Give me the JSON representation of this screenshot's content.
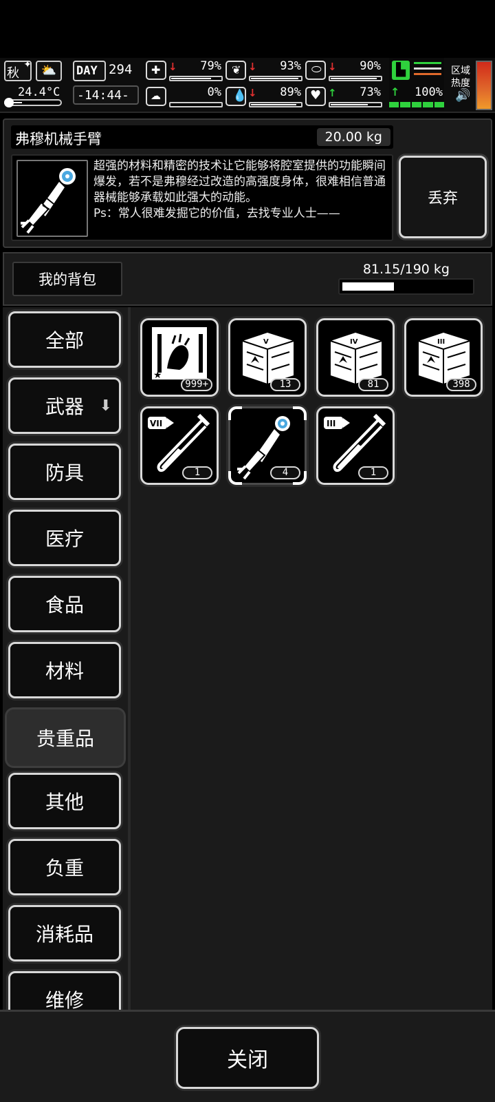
{
  "hud": {
    "season": "秋",
    "temperature": "24.4°C",
    "day_label": "DAY",
    "day": "294",
    "time": "-14:44-",
    "region_heat_label_1": "区域",
    "region_heat_label_2": "热度",
    "stats": [
      {
        "name": "health",
        "arrow": "↓",
        "dir": "down",
        "value": "79%",
        "level": 0.79
      },
      {
        "name": "hunger",
        "arrow": "↓",
        "dir": "down",
        "value": "93%",
        "level": 0.93
      },
      {
        "name": "pill",
        "arrow": "↓",
        "dir": "down",
        "value": "90%",
        "level": 0.9
      },
      {
        "name": "mental",
        "arrow": "↓",
        "dir": "down",
        "value": "0%",
        "level": 0.0
      },
      {
        "name": "thirst",
        "arrow": "↓",
        "dir": "down",
        "value": "89%",
        "level": 0.89
      },
      {
        "name": "mood",
        "arrow": "↑",
        "dir": "up",
        "value": "73%",
        "level": 0.73
      }
    ],
    "stamina": {
      "arrow": "↑",
      "value": "100%",
      "level": 1.0
    }
  },
  "item": {
    "name": "弗穆机械手臂",
    "weight": "20.00 kg",
    "description": "超强的材料和精密的技术让它能够将腔室提供的功能瞬间爆发，若不是弗穆经过改造的高强度身体，很难相信普通器械能够承载如此强大的动能。",
    "description_ps": "Ps：常人很难发掘它的价值，去找专业人士——",
    "discard_label": "丢弃",
    "icon": "mechanical-arm-icon"
  },
  "bag": {
    "title": "我的背包",
    "weight_text": "81.15/190 kg",
    "weight_fraction": 0.427
  },
  "categories": [
    {
      "label": "全部"
    },
    {
      "label": "武器",
      "icon": "download-arrow-icon"
    },
    {
      "label": "防具"
    },
    {
      "label": "医疗"
    },
    {
      "label": "食品"
    },
    {
      "label": "材料"
    },
    {
      "label": "贵重品",
      "active": true
    },
    {
      "label": "其他"
    },
    {
      "label": "负重"
    },
    {
      "label": "消耗品"
    },
    {
      "label": "维修"
    }
  ],
  "items": [
    {
      "icon": "photo-frame-icon",
      "count": "999+"
    },
    {
      "icon": "crate-v-icon",
      "count": "13"
    },
    {
      "icon": "crate-iv-icon",
      "count": "81"
    },
    {
      "icon": "crate-iii-icon",
      "count": "398"
    },
    {
      "icon": "test-tube-vii-icon",
      "count": "1"
    },
    {
      "icon": "mechanical-arm-icon",
      "count": "4",
      "selected": true
    },
    {
      "icon": "test-tube-iii-icon",
      "count": "1"
    }
  ],
  "footer": {
    "close_label": "关闭"
  }
}
